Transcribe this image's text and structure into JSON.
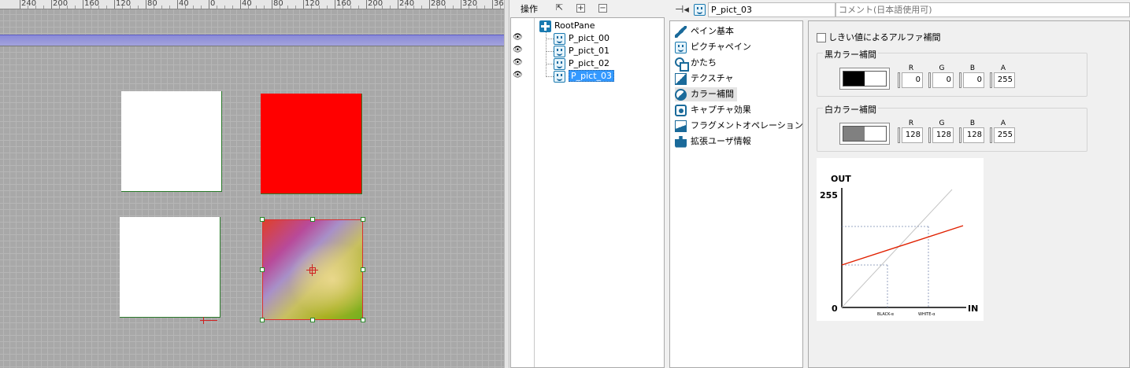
{
  "ruler": {
    "labels": [
      "240",
      "200",
      "160",
      "120",
      "80",
      "40",
      "0",
      "40",
      "80",
      "120",
      "160",
      "200",
      "240",
      "280",
      "320",
      "360"
    ]
  },
  "hierarchy": {
    "toolbar_label": "操作",
    "nodes": [
      {
        "label": "RootPane",
        "visible": false,
        "selected": false
      },
      {
        "label": "P_pict_00",
        "visible": true,
        "selected": false
      },
      {
        "label": "P_pict_01",
        "visible": true,
        "selected": false
      },
      {
        "label": "P_pict_02",
        "visible": true,
        "selected": false
      },
      {
        "label": "P_pict_03",
        "visible": true,
        "selected": true
      }
    ]
  },
  "header": {
    "pane_name": "P_pict_03",
    "comment_placeholder": "コメント(日本語使用可)"
  },
  "categories": [
    {
      "label": "ペイン基本",
      "icon": "pencil-icon",
      "selected": false
    },
    {
      "label": "ピクチャペイン",
      "icon": "smiley-icon",
      "selected": false
    },
    {
      "label": "かたち",
      "icon": "shapes-icon",
      "selected": false
    },
    {
      "label": "テクスチャ",
      "icon": "texture-icon",
      "selected": false
    },
    {
      "label": "カラー補間",
      "icon": "color-interpolation-icon",
      "selected": true
    },
    {
      "label": "キャプチャ効果",
      "icon": "capture-icon",
      "selected": false
    },
    {
      "label": "フラグメントオペレーション",
      "icon": "fragment-icon",
      "selected": false
    },
    {
      "label": "拡張ユーザ情報",
      "icon": "puzzle-icon",
      "selected": false
    }
  ],
  "color_interp": {
    "alpha_threshold_label": "しきい値によるアルファ補間",
    "alpha_threshold_checked": false,
    "black": {
      "title": "黒カラー補間",
      "swatch_color": "#000000",
      "channels": [
        {
          "name": "R",
          "value": "0"
        },
        {
          "name": "G",
          "value": "0"
        },
        {
          "name": "B",
          "value": "0"
        },
        {
          "name": "A",
          "value": "255"
        }
      ]
    },
    "white": {
      "title": "白カラー補間",
      "swatch_color": "#808080",
      "channels": [
        {
          "name": "R",
          "value": "128"
        },
        {
          "name": "G",
          "value": "128"
        },
        {
          "name": "B",
          "value": "128"
        },
        {
          "name": "A",
          "value": "255"
        }
      ]
    }
  },
  "graph": {
    "out_label": "OUT",
    "in_label": "IN",
    "max_label": "255",
    "zero_label": "0",
    "black_tick": "BLACK-α",
    "white_tick": "WHITE-α",
    "line_color": "#e02000"
  },
  "colors": {
    "selection": "#3399ff",
    "accent": "#1a7ab0",
    "pane_red": "#ff0000"
  }
}
